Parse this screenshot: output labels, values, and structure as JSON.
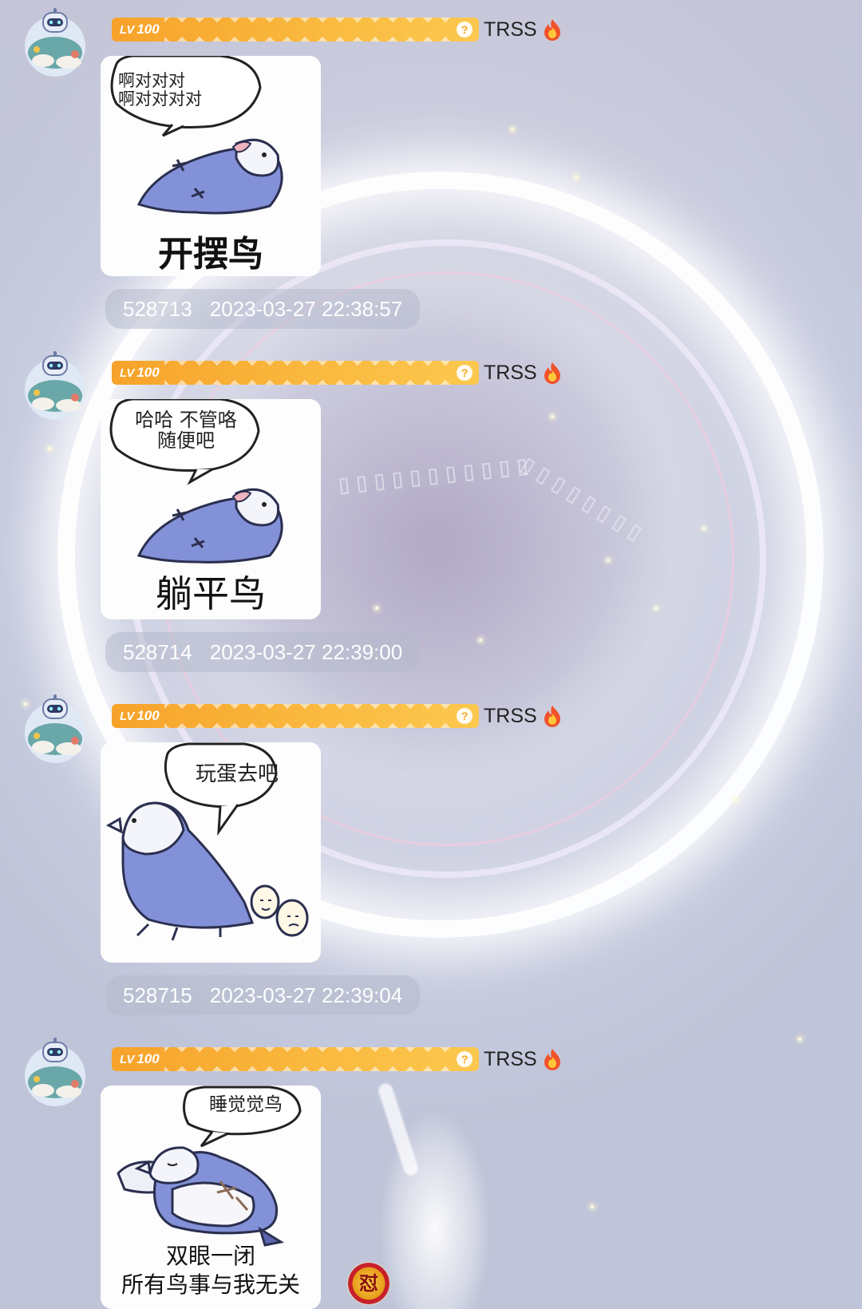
{
  "user": {
    "level_prefix": "LV",
    "level": "100",
    "badge_help": "?",
    "nickname": "TRSS"
  },
  "messages": [
    {
      "id": "528713",
      "time": "2023-03-27 22:38:57",
      "sticker_bubble": "啊对对对\n啊对对对对",
      "sticker_caption": "开摆鸟"
    },
    {
      "id": "528714",
      "time": "2023-03-27 22:39:00",
      "sticker_bubble": "哈哈 不管咯\n随便吧",
      "sticker_caption": "躺平鸟"
    },
    {
      "id": "528715",
      "time": "2023-03-27 22:39:04",
      "sticker_bubble": "玩蛋去吧",
      "sticker_caption": ""
    },
    {
      "sticker_bubble": "睡觉觉鸟",
      "sticker_caption": "双眼一闭\n所有鸟事与我无关"
    }
  ],
  "reaction": {
    "icon": "dui-emoji-icon",
    "glyph": "怼"
  },
  "colors": {
    "level_bar": "#f9b53b",
    "meta_pill": "#b4bacc",
    "bird": "#7f8cd6"
  }
}
